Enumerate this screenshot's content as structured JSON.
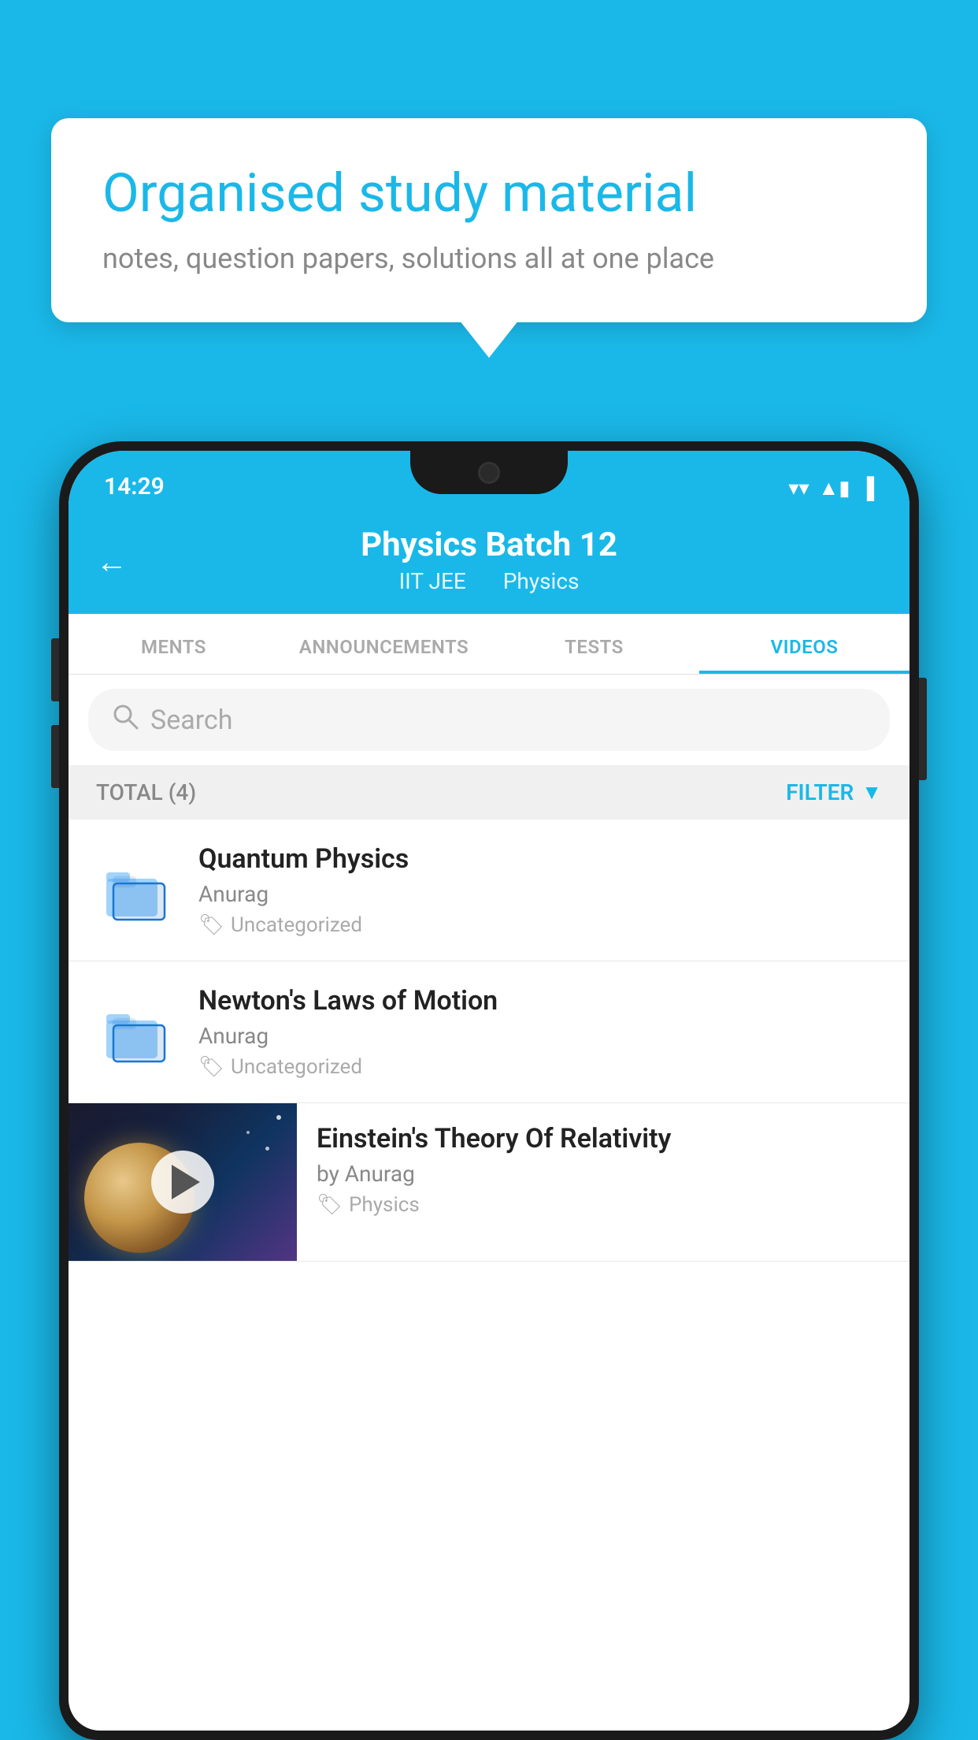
{
  "background_color": "#1ab8e8",
  "speech_bubble": {
    "title": "Organised study material",
    "subtitle": "notes, question papers, solutions all at one place"
  },
  "status_bar": {
    "time": "14:29",
    "wifi": "▼",
    "signal": "▲",
    "battery": "▮"
  },
  "header": {
    "title": "Physics Batch 12",
    "subtitle_part1": "IIT JEE",
    "subtitle_part2": "Physics",
    "back_label": "←"
  },
  "tabs": [
    {
      "label": "MENTS",
      "active": false
    },
    {
      "label": "ANNOUNCEMENTS",
      "active": false
    },
    {
      "label": "TESTS",
      "active": false
    },
    {
      "label": "VIDEOS",
      "active": true
    }
  ],
  "search": {
    "placeholder": "Search"
  },
  "filter": {
    "total_label": "TOTAL (4)",
    "filter_label": "FILTER"
  },
  "videos": [
    {
      "id": 1,
      "title": "Quantum Physics",
      "author": "Anurag",
      "tag": "Uncategorized",
      "type": "folder"
    },
    {
      "id": 2,
      "title": "Newton's Laws of Motion",
      "author": "Anurag",
      "tag": "Uncategorized",
      "type": "folder"
    },
    {
      "id": 3,
      "title": "Einstein's Theory Of Relativity",
      "author": "by Anurag",
      "tag": "Physics",
      "type": "video"
    }
  ]
}
